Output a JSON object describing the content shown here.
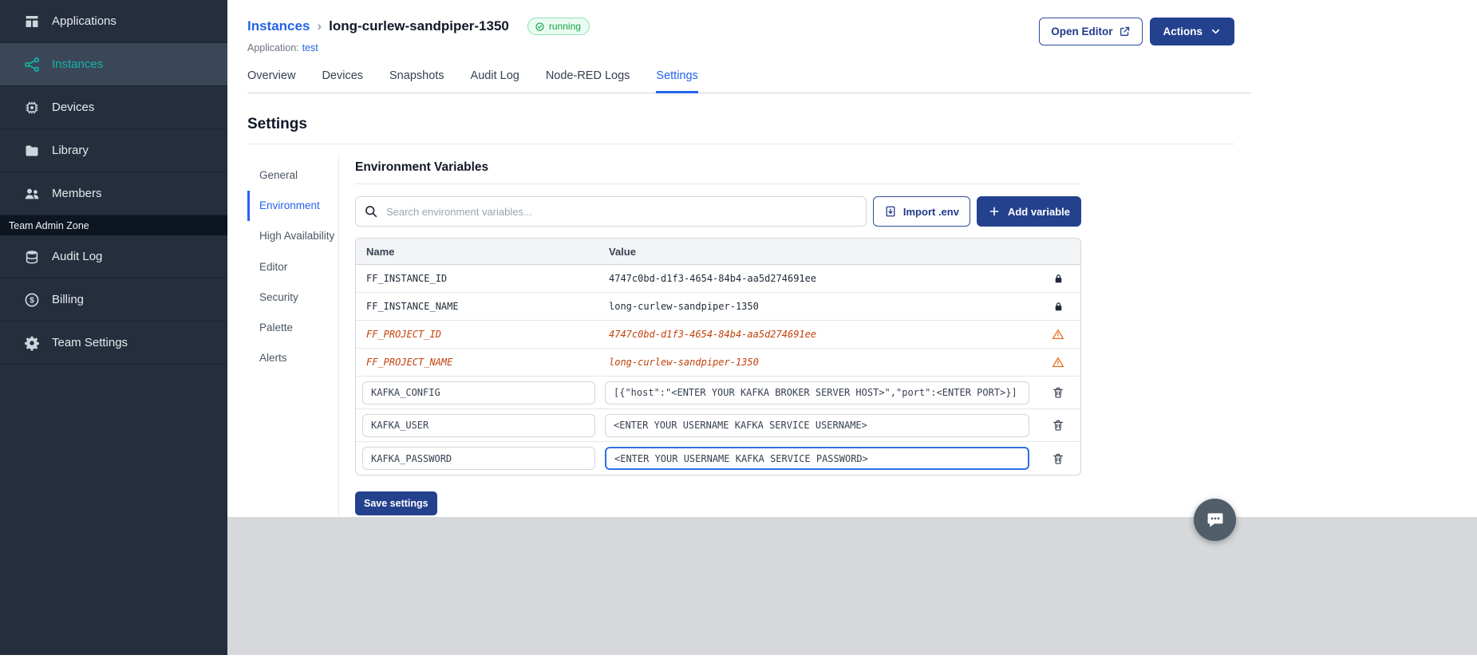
{
  "sidebar": {
    "items": [
      {
        "label": "Applications"
      },
      {
        "label": "Instances"
      },
      {
        "label": "Devices"
      },
      {
        "label": "Library"
      },
      {
        "label": "Members"
      }
    ],
    "section_label": "Team Admin Zone",
    "admin_items": [
      {
        "label": "Audit Log"
      },
      {
        "label": "Billing"
      },
      {
        "label": "Team Settings"
      }
    ]
  },
  "header": {
    "breadcrumb_parent": "Instances",
    "separator": "›",
    "instance_name": "long-curlew-sandpiper-1350",
    "status_label": "running",
    "application_label": "Application:",
    "application_link": "test",
    "open_editor_label": "Open Editor",
    "actions_label": "Actions"
  },
  "tabs": [
    {
      "label": "Overview"
    },
    {
      "label": "Devices"
    },
    {
      "label": "Snapshots"
    },
    {
      "label": "Audit Log"
    },
    {
      "label": "Node-RED Logs"
    },
    {
      "label": "Settings"
    }
  ],
  "settings": {
    "title": "Settings",
    "nav": [
      {
        "label": "General"
      },
      {
        "label": "Environment"
      },
      {
        "label": "High Availability"
      },
      {
        "label": "Editor"
      },
      {
        "label": "Security"
      },
      {
        "label": "Palette"
      },
      {
        "label": "Alerts"
      }
    ]
  },
  "env": {
    "title": "Environment Variables",
    "search_placeholder": "Search environment variables...",
    "import_label": "Import .env",
    "add_label": "Add variable",
    "columns": [
      "Name",
      "Value"
    ],
    "rows": [
      {
        "name": "FF_INSTANCE_ID",
        "value": "4747c0bd-d1f3-4654-84b4-aa5d274691ee",
        "type": "locked"
      },
      {
        "name": "FF_INSTANCE_NAME",
        "value": "long-curlew-sandpiper-1350",
        "type": "locked"
      },
      {
        "name": "FF_PROJECT_ID",
        "value": "4747c0bd-d1f3-4654-84b4-aa5d274691ee",
        "type": "deprecated"
      },
      {
        "name": "FF_PROJECT_NAME",
        "value": "long-curlew-sandpiper-1350",
        "type": "deprecated"
      },
      {
        "name": "KAFKA_CONFIG",
        "value": "[{\"host\":\"<ENTER YOUR KAFKA BROKER SERVER HOST>\",\"port\":<ENTER PORT>}]",
        "type": "editable"
      },
      {
        "name": "KAFKA_USER",
        "value": "<ENTER YOUR USERNAME KAFKA SERVICE USERNAME>",
        "type": "editable"
      },
      {
        "name": "KAFKA_PASSWORD",
        "value": "<ENTER YOUR USERNAME KAFKA SERVICE PASSWORD>",
        "type": "editable",
        "focused": true
      }
    ],
    "save_label": "Save settings"
  },
  "colors": {
    "accent_blue": "#2563eb",
    "navy_button": "#24418e",
    "sidebar_bg": "#242e3d",
    "active_teal": "#12b5a5",
    "status_green": "#16a34a",
    "deprecated_orange": "#c2410c"
  }
}
